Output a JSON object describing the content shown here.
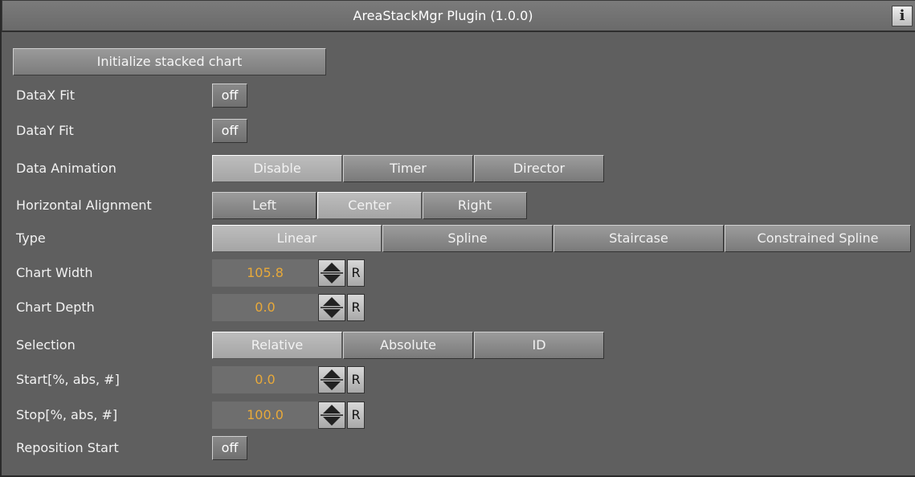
{
  "window": {
    "title": "AreaStackMgr Plugin (1.0.0)",
    "info_label": "i"
  },
  "init_button": "Initialize stacked chart",
  "rows": {
    "datax_fit": {
      "label": "DataX Fit",
      "value": "off"
    },
    "datay_fit": {
      "label": "DataY Fit",
      "value": "off"
    },
    "data_animation": {
      "label": "Data Animation",
      "options": [
        "Disable",
        "Timer",
        "Director"
      ],
      "selected": "Disable"
    },
    "horizontal_alignment": {
      "label": "Horizontal Alignment",
      "options": [
        "Left",
        "Center",
        "Right"
      ],
      "selected": "Center"
    },
    "type": {
      "label": "Type",
      "options": [
        "Linear",
        "Spline",
        "Staircase",
        "Constrained Spline"
      ],
      "selected": "Linear"
    },
    "chart_width": {
      "label": "Chart Width",
      "value": "105.8",
      "reset": "R"
    },
    "chart_depth": {
      "label": "Chart Depth",
      "value": "0.0",
      "reset": "R"
    },
    "selection": {
      "label": "Selection",
      "options": [
        "Relative",
        "Absolute",
        "ID"
      ],
      "selected": "Relative"
    },
    "start": {
      "label": "Start[%, abs, #]",
      "value": "0.0",
      "reset": "R"
    },
    "stop": {
      "label": "Stop[%, abs, #]",
      "value": "100.0",
      "reset": "R"
    },
    "reposition_start": {
      "label": "Reposition Start",
      "value": "off"
    }
  },
  "colors": {
    "background": "#5f5f5f",
    "value_text": "#e8a93a",
    "selected_segment": "#b0b0b0"
  }
}
